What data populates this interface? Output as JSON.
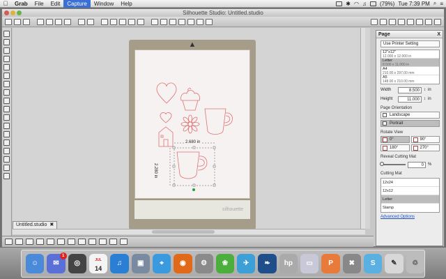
{
  "menubar": {
    "app": "Grab",
    "items": [
      "File",
      "Edit",
      "Capture",
      "Window",
      "Help"
    ],
    "selected": "Capture",
    "battery": "(79%)",
    "clock": "Tue 7:39 PM"
  },
  "window": {
    "title": "Silhouette Studio: Untitled.studio"
  },
  "canvas": {
    "mat_logo": "silhouette",
    "dimension_width": "2.680 in",
    "dimension_height": "2.280 in"
  },
  "doc_tabs": [
    {
      "label": "Untitled.studio"
    }
  ],
  "panel": {
    "title": "Page",
    "close": "X",
    "use_printer_setting": "Use Printer Setting",
    "page_sizes": [
      {
        "name": "12\"x12\"",
        "dims": "12.000 x 12.000 in"
      },
      {
        "name": "Letter",
        "dims": "8.500 x 11.000 in",
        "selected": true
      },
      {
        "name": "A4",
        "dims": "210.00 x 297.00 mm"
      },
      {
        "name": "A5",
        "dims": "148.00 x 210.00 mm"
      }
    ],
    "width_label": "Width",
    "width_value": "8.500",
    "height_label": "Height",
    "height_value": "11.000",
    "unit": "in",
    "orientation_label": "Page Orientation",
    "orientation_options": [
      {
        "label": "Landscape",
        "selected": false
      },
      {
        "label": "Portrait",
        "selected": true
      }
    ],
    "rotate_label": "Rotate View",
    "rotate_options": [
      {
        "label": "0°",
        "selected": true
      },
      {
        "label": "90°",
        "selected": false
      },
      {
        "label": "180°",
        "selected": false
      },
      {
        "label": "270°",
        "selected": false
      }
    ],
    "reveal_label": "Reveal Cutting Mat",
    "reveal_value": "0",
    "reveal_unit": "%",
    "cutting_mat_label": "Cutting Mat",
    "cutting_mats": [
      {
        "label": "12x24",
        "selected": false
      },
      {
        "label": "12x12",
        "selected": false
      },
      {
        "label": "Letter",
        "selected": true
      },
      {
        "label": "Stamp",
        "selected": false
      }
    ],
    "advanced_link": "Advanced Options"
  },
  "dock": {
    "calendar_month": "JUL",
    "calendar_day": "14",
    "mail_badge": "1"
  },
  "colors": {
    "accent": "#3a6fd6",
    "cut_line": "#e07070",
    "mat": "#a59d8a"
  }
}
